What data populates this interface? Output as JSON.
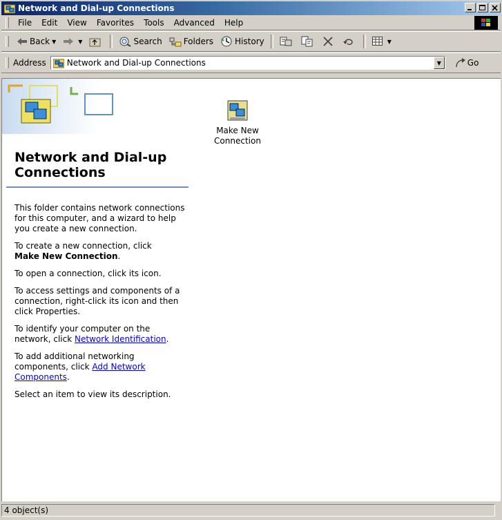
{
  "window": {
    "title": "Network and Dial-up Connections"
  },
  "menu": [
    "File",
    "Edit",
    "View",
    "Favorites",
    "Tools",
    "Advanced",
    "Help"
  ],
  "toolbar": {
    "back": "Back",
    "search": "Search",
    "folders": "Folders",
    "history": "History"
  },
  "address": {
    "label": "Address",
    "value": "Network and Dial-up Connections",
    "go": "Go"
  },
  "pane": {
    "title": "Network and Dial-up Connections",
    "p1": "This folder contains network connections for this computer, and a wizard to help you create a new connection.",
    "p2_prefix": "To create a new connection, click",
    "p2_bold": "Make New Connection",
    "p2_suffix": ".",
    "p3": "To open a connection, click its icon.",
    "p4": "To access settings and components of a connection, right-click its icon and then click Properties.",
    "p5_prefix": "To identify your computer on the network, click",
    "p5_link": "Network Identification",
    "p5_suffix": ".",
    "p6_prefix": "To add additional networking components, click",
    "p6_link": "Add Network Components",
    "p6_suffix": ".",
    "p7": "Select an item to view its description."
  },
  "items": [
    {
      "label": "Make New Connection",
      "icon": "network-computer-icon"
    }
  ],
  "status": {
    "text": "4 object(s)"
  },
  "colors": {
    "titlebar_start": "#0a246a",
    "titlebar_end": "#a6caf0",
    "link": "#0000ee",
    "face": "#d4d0c8"
  }
}
